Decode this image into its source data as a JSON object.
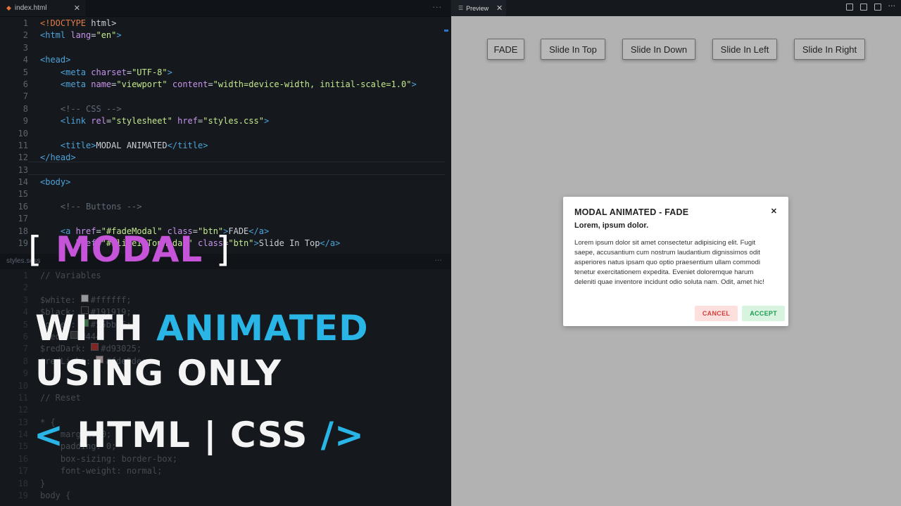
{
  "editor": {
    "tab_label": "index.html",
    "tab_close": "✕",
    "more": "···",
    "lines": [
      {
        "n": "1",
        "segs": [
          [
            "t-doc",
            "<!DOCTYPE"
          ],
          [
            "lc",
            " html>"
          ]
        ]
      },
      {
        "n": "2",
        "segs": [
          [
            "t-tag",
            "<html"
          ],
          [
            "t-attr",
            " lang"
          ],
          [
            "lc",
            "="
          ],
          [
            "t-str",
            "\"en\""
          ],
          [
            "t-tag",
            ">"
          ]
        ]
      },
      {
        "n": "3",
        "segs": []
      },
      {
        "n": "4",
        "segs": [
          [
            "t-tag",
            "<head>"
          ]
        ]
      },
      {
        "n": "5",
        "segs": [
          [
            "lc",
            "    "
          ],
          [
            "t-tag",
            "<meta"
          ],
          [
            "t-attr",
            " charset"
          ],
          [
            "lc",
            "="
          ],
          [
            "t-str",
            "\"UTF-8\""
          ],
          [
            "t-tag",
            ">"
          ]
        ]
      },
      {
        "n": "6",
        "segs": [
          [
            "lc",
            "    "
          ],
          [
            "t-tag",
            "<meta"
          ],
          [
            "t-attr",
            " name"
          ],
          [
            "lc",
            "="
          ],
          [
            "t-str",
            "\"viewport\""
          ],
          [
            "t-attr",
            " content"
          ],
          [
            "lc",
            "="
          ],
          [
            "t-str",
            "\"width=device-width, initial-scale=1.0\""
          ],
          [
            "t-tag",
            ">"
          ]
        ]
      },
      {
        "n": "7",
        "segs": []
      },
      {
        "n": "8",
        "segs": [
          [
            "lc",
            "    "
          ],
          [
            "t-com",
            "<!-- CSS -->"
          ]
        ]
      },
      {
        "n": "9",
        "segs": [
          [
            "lc",
            "    "
          ],
          [
            "t-tag",
            "<link"
          ],
          [
            "t-attr",
            " rel"
          ],
          [
            "lc",
            "="
          ],
          [
            "t-str",
            "\"stylesheet\""
          ],
          [
            "t-attr",
            " href"
          ],
          [
            "lc",
            "="
          ],
          [
            "t-str",
            "\"styles.css\""
          ],
          [
            "t-tag",
            ">"
          ]
        ]
      },
      {
        "n": "10",
        "segs": []
      },
      {
        "n": "11",
        "segs": [
          [
            "lc",
            "    "
          ],
          [
            "t-tag",
            "<title>"
          ],
          [
            "lc",
            "MODAL ANIMATED"
          ],
          [
            "t-tag",
            "</title>"
          ]
        ]
      },
      {
        "n": "12",
        "segs": [
          [
            "t-tag",
            "</head>"
          ]
        ]
      },
      {
        "n": "13",
        "segs": []
      },
      {
        "n": "14",
        "segs": [
          [
            "t-tag",
            "<body>"
          ]
        ]
      },
      {
        "n": "15",
        "segs": []
      },
      {
        "n": "16",
        "segs": [
          [
            "lc",
            "    "
          ],
          [
            "t-com",
            "<!-- Buttons -->"
          ]
        ]
      },
      {
        "n": "17",
        "segs": []
      },
      {
        "n": "18",
        "segs": [
          [
            "lc",
            "    "
          ],
          [
            "t-tag",
            "<a"
          ],
          [
            "t-attr",
            " href"
          ],
          [
            "lc",
            "="
          ],
          [
            "t-str",
            "\"#fadeModal\""
          ],
          [
            "t-attr",
            " class"
          ],
          [
            "lc",
            "="
          ],
          [
            "t-str",
            "\"btn\""
          ],
          [
            "t-tag",
            ">"
          ],
          [
            "lc",
            "FADE"
          ],
          [
            "t-tag",
            "</a>"
          ]
        ]
      },
      {
        "n": "19",
        "segs": [
          [
            "lc",
            "    "
          ],
          [
            "t-tag",
            "<a"
          ],
          [
            "t-attr",
            " href"
          ],
          [
            "lc",
            "="
          ],
          [
            "t-str",
            "\"#slideInTopModal\""
          ],
          [
            "t-attr",
            " class"
          ],
          [
            "lc",
            "="
          ],
          [
            "t-str",
            "\"btn\""
          ],
          [
            "t-tag",
            ">"
          ],
          [
            "lc",
            "Slide In Top"
          ],
          [
            "t-tag",
            "</a>"
          ]
        ]
      }
    ]
  },
  "editor2": {
    "tab_label": "styles.scss",
    "more": "···",
    "lines": [
      {
        "n": "1",
        "t": "// Variables"
      },
      {
        "n": "2",
        "t": ""
      },
      {
        "n": "3",
        "t": "$white: ",
        "sw": "#ffffff",
        "v": "#ffffff;"
      },
      {
        "n": "4",
        "t": "$black: ",
        "sw": "#191919",
        "v": "#191919;"
      },
      {
        "n": "5",
        "t": "$green: ",
        "sw": "#55bb66",
        "v": "#55bb66;"
      },
      {
        "n": "6",
        "t": "$red: ",
        "sw": "#444444",
        "v": "#444;"
      },
      {
        "n": "7",
        "t": "$redDark: ",
        "sw": "#d93025",
        "v": "#d93025;"
      },
      {
        "n": "8",
        "t": "$redLight: ",
        "sw": "#fde0de",
        "v": "#fde0de;"
      },
      {
        "n": "9",
        "t": ""
      },
      {
        "n": "10",
        "t": ""
      },
      {
        "n": "11",
        "t": "// Reset"
      },
      {
        "n": "12",
        "t": ""
      },
      {
        "n": "13",
        "t": "* {"
      },
      {
        "n": "14",
        "t": "    margin: 0;"
      },
      {
        "n": "15",
        "t": "    padding: 0;"
      },
      {
        "n": "16",
        "t": "    box-sizing: border-box;"
      },
      {
        "n": "17",
        "t": "    font-weight: normal;"
      },
      {
        "n": "18",
        "t": "}"
      },
      {
        "n": "19",
        "t": "body {"
      }
    ]
  },
  "overlay": {
    "bracket_open": "[",
    "modal_word": "MODAL",
    "bracket_close": "]",
    "with": "WITH",
    "animated": "ANIMATED",
    "using_only": "USING ONLY",
    "lt": "<",
    "html_css": "HTML | CSS",
    "slash_gt": "/>"
  },
  "preview": {
    "tab_label": "Preview",
    "tab_close": "✕",
    "buttons": [
      "FADE",
      "Slide In Top",
      "Slide In Down",
      "Slide In Left",
      "Slide In Right"
    ],
    "modal": {
      "title": "MODAL ANIMATED - FADE",
      "close": "✕",
      "subtitle": "Lorem, ipsum dolor.",
      "body": "Lorem ipsum dolor sit amet consectetur adipisicing elit. Fugit saepe, accusantium cum nostrum laudantium dignissimos odit asperiores natus ipsam quo optio praesentium ullam commodi tenetur exercitationem expedita. Eveniet doloremque harum deleniti quae inventore incidunt odio soluta nam. Odit, amet hic!",
      "cancel": "CANCEL",
      "accept": "ACCEPT"
    }
  },
  "colors": {
    "accent_pink": "#c654d8",
    "accent_cyan": "#29b6e6",
    "cancel_text": "#d0403a",
    "accept_text": "#1c9b4f"
  }
}
